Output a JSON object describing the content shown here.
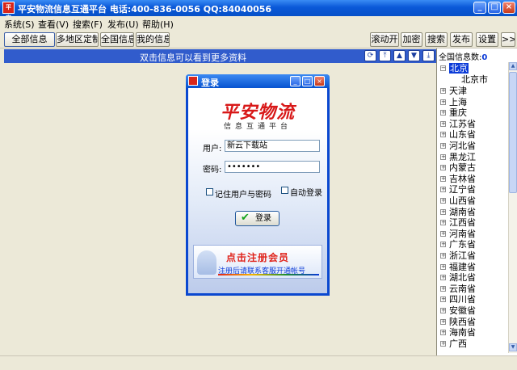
{
  "window": {
    "title": "平安物流信息互通平台   电话:400-836-0056 QQ:84040056",
    "icon_text": "平安",
    "minimize": "_",
    "maximize": "□",
    "close": "×"
  },
  "menu": [
    "系统(S)",
    "查看(V)",
    "搜索(F)",
    "发布(U)",
    "帮助(H)"
  ],
  "toolbar": {
    "left": [
      "全部信息",
      "多地区定制",
      "全国信息",
      "我的信息"
    ],
    "right": [
      "滚动开",
      "加密",
      "搜索",
      "发布",
      "设置",
      ">>"
    ]
  },
  "info_bar": {
    "hint": "双击信息可以看到更多资料",
    "nav_icons": [
      "refresh-icon",
      "top-icon",
      "up-icon",
      "down-icon",
      "bottom-icon"
    ]
  },
  "region_panel": {
    "header_label": "全国信息数:",
    "header_count": "0",
    "selected": "北京",
    "selected_child": "北京市",
    "provinces": [
      "北京",
      "天津",
      "上海",
      "重庆",
      "江苏省",
      "山东省",
      "河北省",
      "黑龙江",
      "内蒙古",
      "吉林省",
      "辽宁省",
      "山西省",
      "湖南省",
      "江西省",
      "河南省",
      "广东省",
      "浙江省",
      "福建省",
      "湖北省",
      "云南省",
      "四川省",
      "安徽省",
      "陕西省",
      "海南省",
      "广西"
    ]
  },
  "login_dialog": {
    "title": "登录",
    "brand": "平安物流",
    "brand_sub": "信息互通平台",
    "username_label": "用户:",
    "username_value": "新云下载站",
    "password_label": "密码:",
    "password_value": "•••••••",
    "remember_label": "记住用户与密码",
    "auto_login_label": "自动登录",
    "login_button": "登录",
    "register_title": "点击注册会员",
    "register_sub": "注册后请联系客服开通帐号"
  }
}
